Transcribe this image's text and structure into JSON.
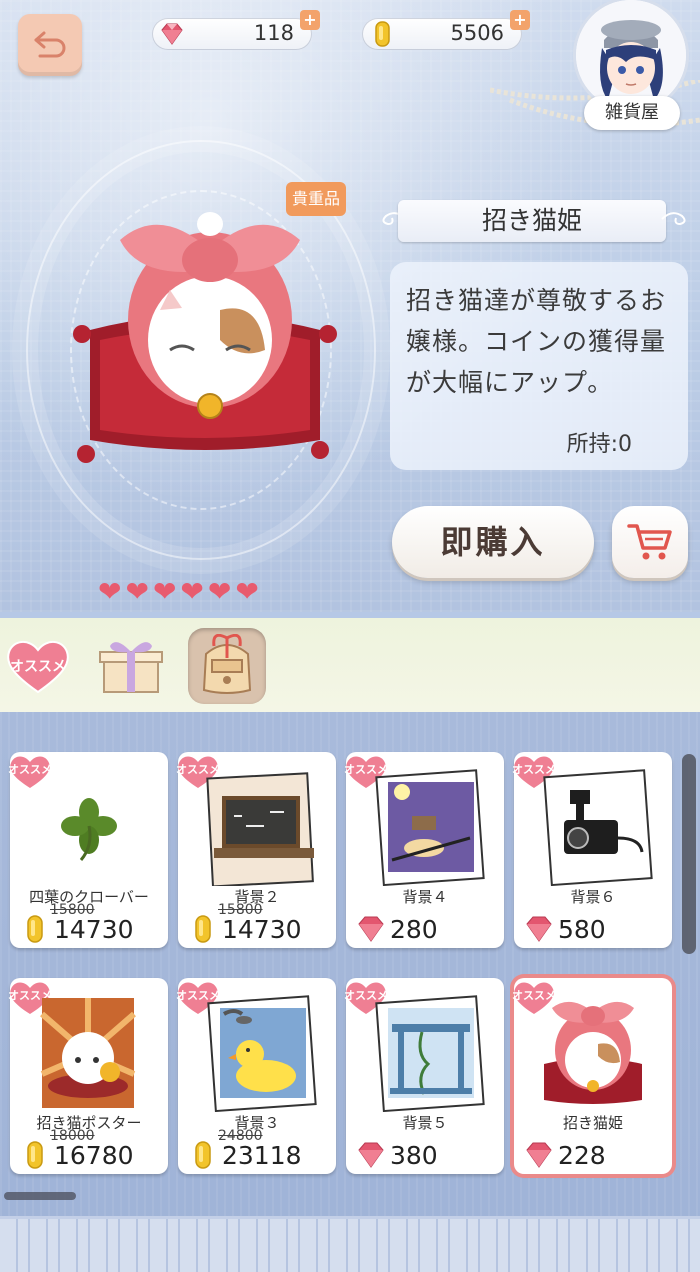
{
  "header": {
    "diamonds": "118",
    "coins": "5506",
    "plus": "+",
    "shop_name": "雑貨屋"
  },
  "item": {
    "rarity_badge": "貴重品",
    "name": "招き猫姫",
    "description": "招き猫達が尊敬するお嬢様。コインの獲得量が大幅にアップ。",
    "owned": "所持:0",
    "buy_label": "即購入",
    "hearts": 6
  },
  "categories": [
    {
      "label": "オススメ",
      "icon": "osusume-heart-icon",
      "active": false
    },
    {
      "label": "",
      "icon": "gift-box-icon",
      "active": false
    },
    {
      "label": "",
      "icon": "backpack-icon",
      "active": true
    }
  ],
  "recommend_label": "オススメ",
  "products": [
    {
      "name": "四葉のクローバー",
      "old_price": "15800",
      "price": "14730",
      "currency": "coin",
      "art": "clover-icon"
    },
    {
      "name": "背景２",
      "old_price": "15800",
      "price": "14730",
      "currency": "coin",
      "art": "chalkboard-icon"
    },
    {
      "name": "背景４",
      "old_price": "",
      "price": "280",
      "currency": "diamond",
      "art": "desk-lamp-icon"
    },
    {
      "name": "背景６",
      "old_price": "",
      "price": "580",
      "currency": "diamond",
      "art": "camera-icon"
    },
    {
      "name": "招き猫ポスター",
      "old_price": "18000",
      "price": "16780",
      "currency": "coin",
      "art": "lucky-cat-poster-icon"
    },
    {
      "name": "背景３",
      "old_price": "24800",
      "price": "23118",
      "currency": "coin",
      "art": "rubber-duck-icon"
    },
    {
      "name": "背景５",
      "old_price": "",
      "price": "380",
      "currency": "diamond",
      "art": "window-vine-icon"
    },
    {
      "name": "招き猫姫",
      "old_price": "",
      "price": "228",
      "currency": "diamond",
      "art": "lucky-cat-princess-icon",
      "selected": true
    }
  ],
  "colors": {
    "accent_pink": "#e85b6e",
    "badge_orange": "#f19a5c",
    "selected_border": "#ea8a8a"
  }
}
